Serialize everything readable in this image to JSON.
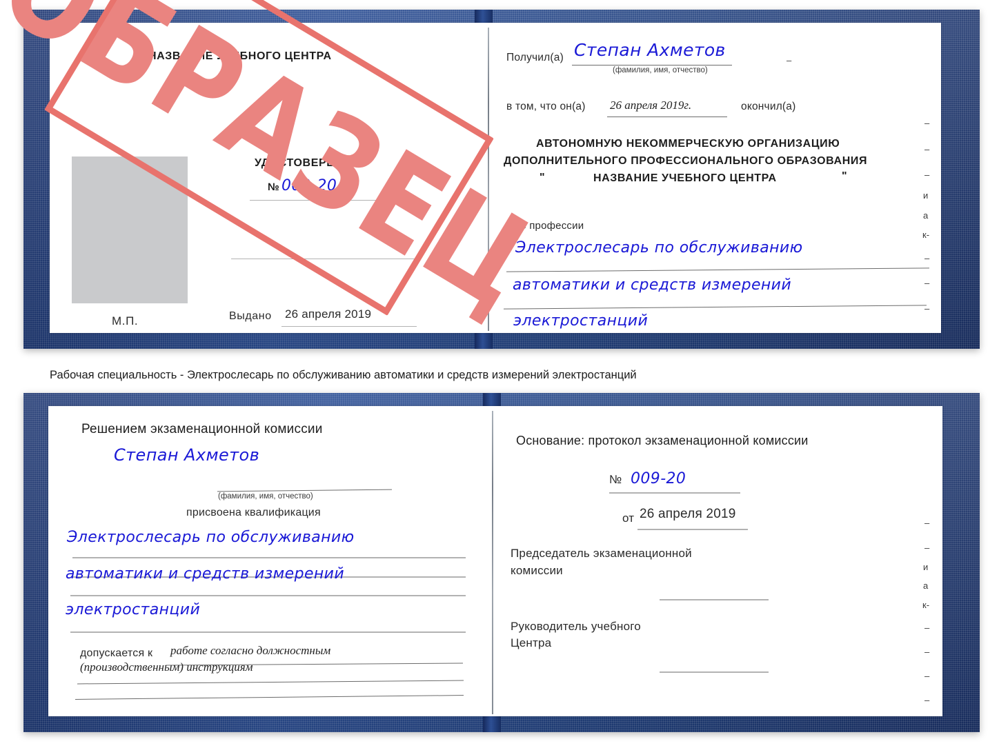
{
  "document": {
    "type": "certificate-scan",
    "stamp_text": "ОБРАЗЕЦ",
    "stamp_color": "#e8736d",
    "cover_color": "#21417f",
    "handwriting_color": "#1a19d6"
  },
  "caption": {
    "text": "Рабочая специальность - Электрослесарь по обслуживанию автоматики и средств измерений электростанций"
  },
  "cert_top": {
    "left_page": {
      "center_name": "НАЗВАНИЕ УЧЕБНОГО ЦЕНТРА",
      "doc_title": "УДОСТОВЕРЕНИЕ",
      "number_label": "№",
      "number_value": "009-20",
      "issued_label": "Выдано",
      "issued_value": "26 апреля 2019",
      "seal_label": "М.П.",
      "photo_placeholder": "photo-box"
    },
    "right_page": {
      "received_label": "Получил(а)",
      "received_value": "Степан Ахметов",
      "received_hint": "(фамилия, имя, отчество)",
      "that_he_label": "в том, что он(а)",
      "that_he_value": "26 апреля 2019г.",
      "finished_label": "окончил(а)",
      "org_line1": "АВТОНОМНУЮ НЕКОММЕРЧЕСКУЮ ОРГАНИЗАЦИЮ",
      "org_line2": "ДОПОЛНИТЕЛЬНОГО ПРОФЕССИОНАЛЬНОГО ОБРАЗОВАНИЯ",
      "org_quote_open": "\"",
      "org_name": "НАЗВАНИЕ УЧЕБНОГО ЦЕНТРА",
      "org_quote_close": "\"",
      "profession_label": "по профессии",
      "profession_line1": "Электрослесарь по обслуживанию",
      "profession_line2": "автоматики и средств измерений",
      "profession_line3": "электростанций",
      "edge_marks": [
        "–",
        "–",
        "–",
        "и",
        "а",
        "к-",
        "–",
        "–",
        "–"
      ]
    }
  },
  "cert_bottom": {
    "left_page": {
      "decision_title": "Решением экзаменационной комиссии",
      "name_value": "Степан Ахметов",
      "name_hint": "(фамилия, имя, отчество)",
      "qualification_label": "присвоена квалификация",
      "qual_line1": "Электрослесарь по обслуживанию",
      "qual_line2": "автоматики и средств измерений",
      "qual_line3": "электростанций",
      "admitted_label": "допускается к",
      "admitted_line1": "работе согласно должностным",
      "admitted_line2": "(производственным) инструкциям"
    },
    "right_page": {
      "basis_label": "Основание: протокол экзаменационной комиссии",
      "protocol_number_label": "№",
      "protocol_number_value": "009-20",
      "protocol_date_label": "от",
      "protocol_date_value": "26 апреля 2019",
      "chairman_line1": "Председатель экзаменационной",
      "chairman_line2": "комиссии",
      "head_line1": "Руководитель учебного",
      "head_line2": "Центра",
      "edge_marks": [
        "–",
        "и",
        "а",
        "к-",
        "–",
        "–",
        "–"
      ]
    }
  }
}
